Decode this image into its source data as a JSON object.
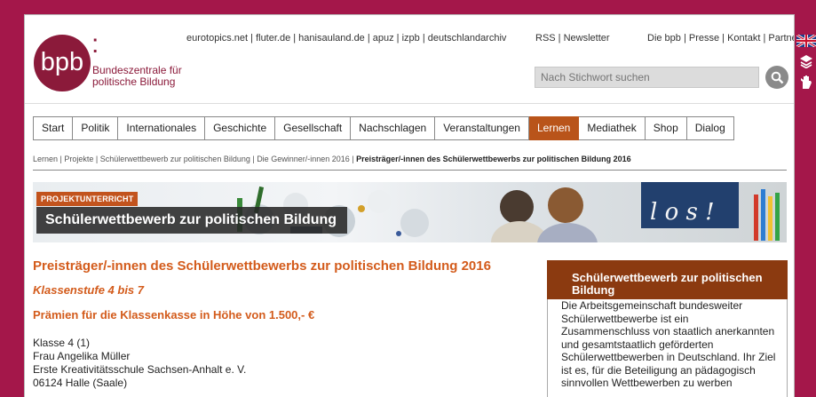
{
  "logo": {
    "mark": "bpb",
    "colon": ":",
    "line1": "Bundeszentrale für",
    "line2": "politische Bildung"
  },
  "partner_links": "eurotopics.net | fluter.de | hanisauland.de | apuz | izpb | deutschlandarchiv",
  "feed_links": "RSS | Newsletter",
  "site_links": "Die bpb | Presse | Kontakt | Partner",
  "search": {
    "placeholder": "Nach Stichwort suchen"
  },
  "side_icons": [
    "uk-flag-icon",
    "sign-language-icon",
    "easy-language-icon"
  ],
  "nav": [
    {
      "label": "Start",
      "active": false
    },
    {
      "label": "Politik",
      "active": false
    },
    {
      "label": "Internationales",
      "active": false
    },
    {
      "label": "Geschichte",
      "active": false
    },
    {
      "label": "Gesellschaft",
      "active": false
    },
    {
      "label": "Nachschlagen",
      "active": false
    },
    {
      "label": "Veranstaltungen",
      "active": false
    },
    {
      "label": "Lernen",
      "active": true
    },
    {
      "label": "Mediathek",
      "active": false
    },
    {
      "label": "Shop",
      "active": false
    },
    {
      "label": "Dialog",
      "active": false
    }
  ],
  "breadcrumb": {
    "items": [
      "Lernen",
      "Projekte",
      "Schülerwettbewerb zur politischen Bildung",
      "Die Gewinner/-innen 2016"
    ],
    "separator": " | ",
    "current": "Preisträger/-innen des Schülerwettbewerbs zur politischen Bildung 2016"
  },
  "banner": {
    "tag": "PROJEKTUNTERRICHT",
    "title": "Schülerwettbewerb zur politischen Bildung"
  },
  "main": {
    "title": "Preisträger/-innen des Schülerwettbewerbs zur politischen Bildung 2016",
    "level": "Klassenstufe 4 bis 7",
    "prize": "Prämien für die Klassenkasse in Höhe von 1.500,- €",
    "winner": [
      "Klasse 4 (1)",
      "Frau Angelika Müller",
      "Erste Kreativitätsschule Sachsen-Anhalt e. V.",
      "06124 Halle (Saale)"
    ]
  },
  "sidebar_box": {
    "title": "Schülerwettbewerb zur politischen Bildung",
    "text": "Die Arbeitsgemeinschaft bundesweiter Schülerwettbewerbe ist ein Zusammenschluss von staatlich anerkannten und gesamtstaatlich geförderten Schülerwettbewerben in Deutschland. Ihr Ziel ist es, für die Beteiligung an pädagogisch sinnvollen Wettbewerben zu werben"
  },
  "colors": {
    "brand": "#8b1a3a",
    "frame": "#a4174a",
    "accent": "#d35b1b",
    "nav_active": "#b9541a",
    "box_head": "#8b3a10"
  }
}
